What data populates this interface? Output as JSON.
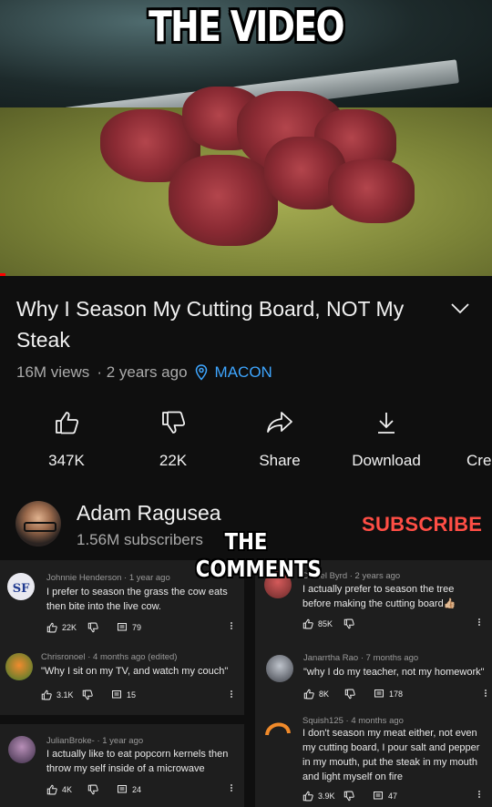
{
  "video": {
    "overlay_caption": "THE VIDEO"
  },
  "info": {
    "title": "Why I Season My Cutting Board, NOT My Steak",
    "views": "16M views",
    "age": "· 2 years ago",
    "location": "MACON"
  },
  "actions": {
    "like": "347K",
    "dislike": "22K",
    "share": "Share",
    "download": "Download",
    "create": "Cre"
  },
  "channel": {
    "name": "Adam Ragusea",
    "subscribers": "1.56M subscribers",
    "subscribe_label": "SUBSCRIBE"
  },
  "comments_overlay": {
    "line1": "THE",
    "line2": "COMMENTS"
  },
  "comments": [
    {
      "author": "Johnnie Henderson",
      "age": "· 1 year ago",
      "text": "I prefer to season the grass the cow eats then bite into the live cow.",
      "likes": "22K",
      "replies": "79"
    },
    {
      "author": "Daniel Byrd",
      "age": "· 2 years ago",
      "text": "I actually prefer to season the tree before making the cutting board👍🏼",
      "likes": "85K",
      "replies": ""
    },
    {
      "author": "Chrisronoel",
      "age": "· 4 months ago (edited)",
      "text": "\"Why I sit on my TV, and watch my couch\"",
      "likes": "3.1K",
      "replies": "15"
    },
    {
      "author": "Janarrtha Rao",
      "age": "· 7 months ago",
      "text": "\"why I do my teacher, not my homework\"",
      "likes": "8K",
      "replies": "178"
    },
    {
      "author": "JulianBroke-",
      "age": "· 1 year ago",
      "text": "I actually like to eat popcorn kernels then throw my self inside of a microwave",
      "likes": "4K",
      "replies": "24"
    },
    {
      "author": "Squish125",
      "age": "· 4 months ago",
      "text": "I don't season my meat either, not even my cutting board, I pour salt and pepper in my mouth, put the steak in my mouth and light myself on fire",
      "likes": "3.9K",
      "replies": "47"
    }
  ],
  "colors": {
    "accent_red": "#ff4e45",
    "link_blue": "#3ea6ff",
    "background": "#0f0f0f"
  }
}
